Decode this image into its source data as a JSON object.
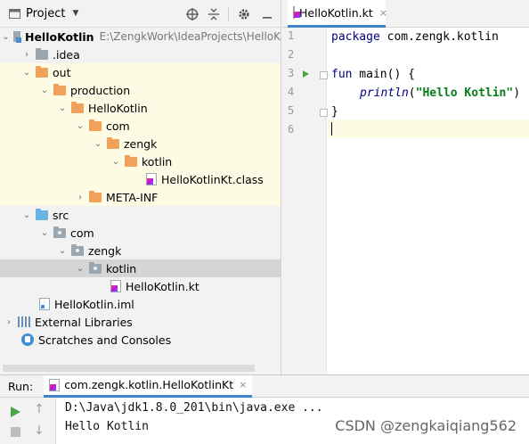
{
  "project_panel": {
    "title": "Project",
    "tools": [
      "crosshair-icon",
      "collapse-all-icon",
      "gear-icon",
      "minimize-icon"
    ],
    "tree": [
      {
        "label": "HelloKotlin",
        "path": "E:\\ZengkWork\\IdeaProjects\\HelloK",
        "kind": "module",
        "expanded": true
      },
      {
        "label": ".idea",
        "kind": "folder",
        "expanded": false
      },
      {
        "label": "out",
        "kind": "folder",
        "expanded": true
      },
      {
        "label": "production",
        "kind": "folder",
        "expanded": true
      },
      {
        "label": "HelloKotlin",
        "kind": "folder",
        "expanded": true
      },
      {
        "label": "com",
        "kind": "folder",
        "expanded": true
      },
      {
        "label": "zengk",
        "kind": "folder",
        "expanded": true
      },
      {
        "label": "kotlin",
        "kind": "folder",
        "expanded": true
      },
      {
        "label": "HelloKotlinKt.class",
        "kind": "kotlin-class-file"
      },
      {
        "label": "META-INF",
        "kind": "folder",
        "expanded": false
      },
      {
        "label": "src",
        "kind": "source-folder",
        "expanded": true
      },
      {
        "label": "com",
        "kind": "package",
        "expanded": true
      },
      {
        "label": "zengk",
        "kind": "package",
        "expanded": true
      },
      {
        "label": "kotlin",
        "kind": "package",
        "expanded": true,
        "selected": true
      },
      {
        "label": "HelloKotlin.kt",
        "kind": "kotlin-file"
      },
      {
        "label": "HelloKotlin.iml",
        "kind": "iml-file"
      },
      {
        "label": "External Libraries",
        "kind": "libraries",
        "expanded": false
      },
      {
        "label": "Scratches and Consoles",
        "kind": "scratches"
      }
    ]
  },
  "editor": {
    "tab_label": "HelloKotlin.kt",
    "tab_close": "×",
    "line_numbers": [
      "1",
      "2",
      "3",
      "4",
      "5",
      "6"
    ],
    "code": {
      "l1_kw": "package",
      "l1_rest": " com.zengk.kotlin",
      "l3_kw": "fun",
      "l3_rest": " main() {",
      "l4_fn": "println",
      "l4_open": "(",
      "l4_str": "\"Hello Kotlin\"",
      "l4_close": ")",
      "l5": "}"
    }
  },
  "run_panel": {
    "label": "Run:",
    "tab_label": "com.zengk.kotlin.HelloKotlinKt",
    "tab_close": "×",
    "output": [
      "D:\\Java\\jdk1.8.0_201\\bin\\java.exe ...",
      "Hello Kotlin"
    ],
    "watermark": "CSDN @zengkaiqiang562"
  },
  "colors": {
    "accent": "#4083c9",
    "run_green": "#49a548",
    "highlight": "#fdfbe3",
    "selection": "#d5d5d5",
    "keyword": "#000080",
    "string": "#067d17"
  }
}
